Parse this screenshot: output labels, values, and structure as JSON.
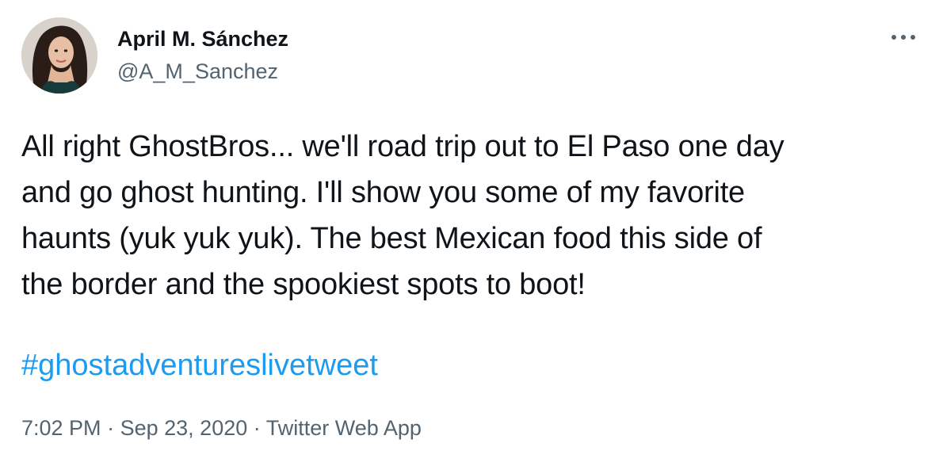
{
  "author": {
    "display_name": "April M. Sánchez",
    "handle": "@A_M_Sanchez"
  },
  "tweet": {
    "text": "All right GhostBros... we'll road trip out to El Paso one day\nand go ghost hunting. I'll show you some of my favorite\nhaunts (yuk yuk yuk). The best Mexican food this side of\nthe border and the spookiest spots to boot!",
    "hashtag": "#ghostadventureslivetweet"
  },
  "meta": {
    "time": "7:02 PM",
    "separator": "·",
    "date": "Sep 23, 2020",
    "source": "Twitter Web App"
  },
  "icons": {
    "more": "more-horizontal-icon",
    "avatar": "profile-photo"
  },
  "colors": {
    "text": "#0f1419",
    "secondary": "#536471",
    "link": "#1d9bf0"
  }
}
